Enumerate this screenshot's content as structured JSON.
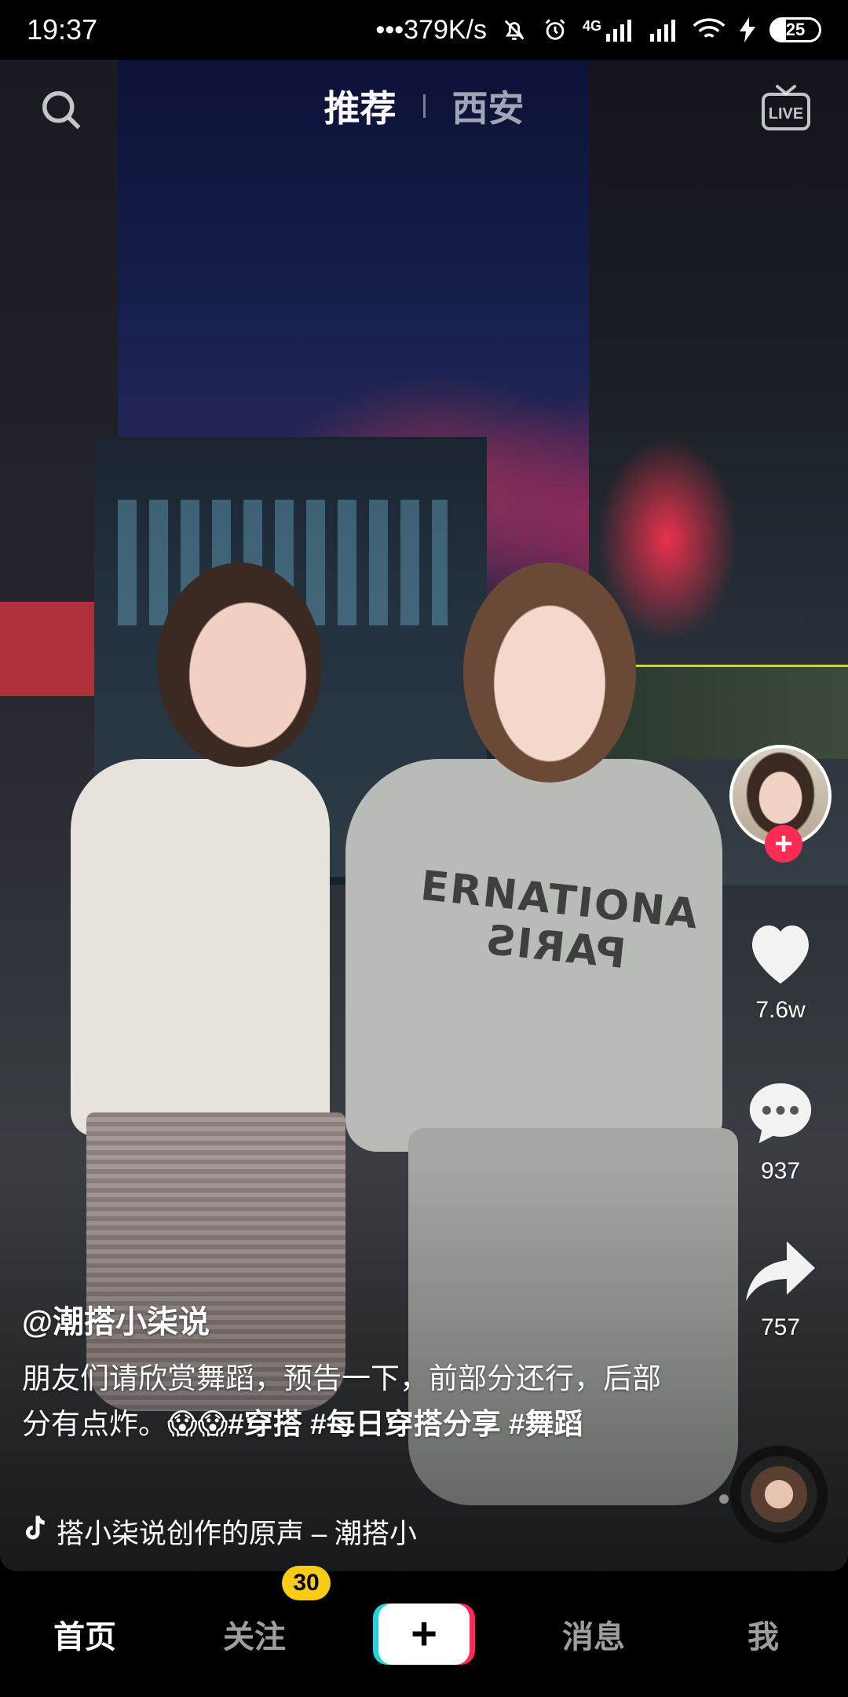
{
  "status_bar": {
    "time": "19:37",
    "network_speed": "•••379K/s",
    "network_type": "4G",
    "battery": "25"
  },
  "top_nav": {
    "tabs": [
      {
        "label": "推荐",
        "active": true
      },
      {
        "label": "西安",
        "active": false
      }
    ],
    "left_icon": "search-icon",
    "right_icon": "live-icon",
    "live_label": "LIVE"
  },
  "video": {
    "shirt_text_line1": "ERNATIONA",
    "shirt_text_line2": "PARIS"
  },
  "actions": {
    "likes": "7.6w",
    "comments": "937",
    "shares": "757",
    "follow_symbol": "+"
  },
  "caption": {
    "author": "@潮搭小柒说",
    "text_parts": [
      {
        "text": "朋友们请欣赏舞蹈，预告一下，前部分还行，后部分有点炸。😱😱",
        "hashtag": false
      },
      {
        "text": "#穿搭 ",
        "hashtag": true
      },
      {
        "text": "#每日穿搭分享 ",
        "hashtag": true
      },
      {
        "text": "#舞蹈",
        "hashtag": true
      }
    ],
    "music": "搭小柒说创作的原声 – 潮搭小"
  },
  "bottom_bar": {
    "home": "首页",
    "following": "关注",
    "following_badge": "30",
    "create": "+",
    "messages": "消息",
    "me": "我"
  },
  "colors": {
    "accent_red": "#fe2c55",
    "accent_cyan": "#23d4dc",
    "badge_yellow": "#facc15"
  }
}
